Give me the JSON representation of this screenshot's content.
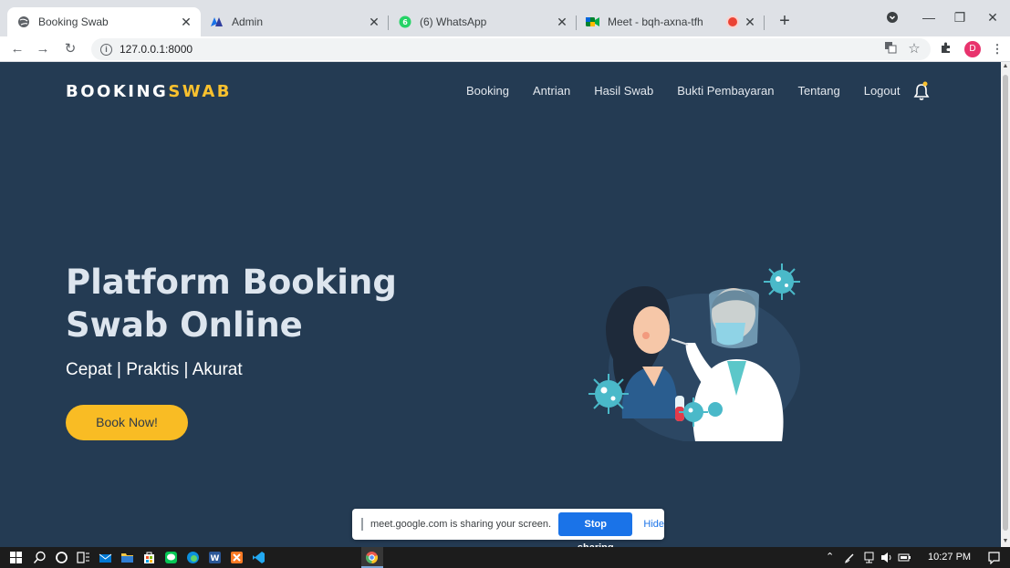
{
  "browser": {
    "tabs": [
      {
        "title": "Booking Swab",
        "active": true,
        "icon": "globe-icon"
      },
      {
        "title": "Admin",
        "active": false,
        "icon": "admin-logo-icon"
      },
      {
        "title": "(6) WhatsApp",
        "active": false,
        "icon": "whatsapp-icon"
      },
      {
        "title": "Meet - bqh-axna-tfh",
        "active": false,
        "icon": "meet-icon",
        "recording": true
      }
    ],
    "address": "127.0.0.1:8000",
    "profile_initial": "D"
  },
  "page": {
    "brand_main": "BOOKING",
    "brand_accent": "SWAB",
    "nav": [
      "Booking",
      "Antrian",
      "Hasil Swab",
      "Bukti Pembayaran",
      "Tentang",
      "Logout"
    ],
    "hero_title": "Platform Booking Swab Online",
    "hero_subtitle": "Cepat | Praktis | Akurat",
    "cta_label": "Book Now!",
    "colors": {
      "background": "#243b53",
      "accent": "#f9c12e"
    }
  },
  "sharebar": {
    "message": "meet.google.com is sharing your screen.",
    "stop_label": "Stop sharing",
    "hide_label": "Hide"
  },
  "taskbar": {
    "time": "10:27 PM"
  }
}
